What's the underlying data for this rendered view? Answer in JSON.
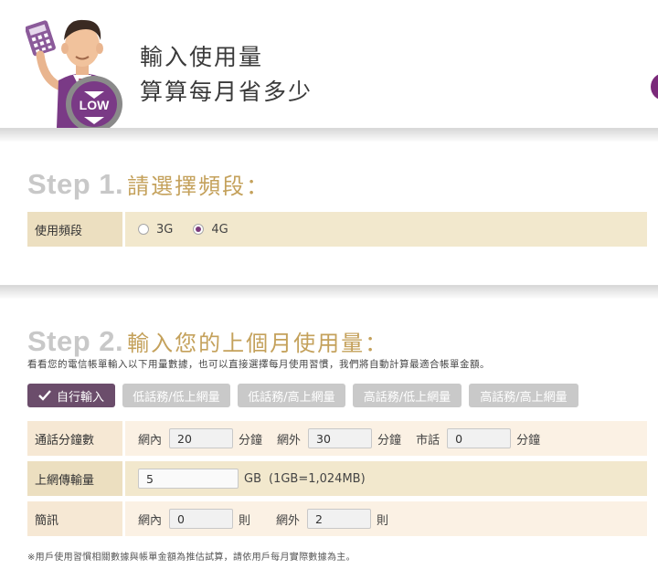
{
  "header": {
    "title_line1": "輸入使用量",
    "title_line2": "算算每月省多少",
    "mascot_badge": "LOW"
  },
  "step1": {
    "num": "Step 1.",
    "title": "請選擇頻段：",
    "row_label": "使用頻段",
    "options": [
      {
        "label": "3G",
        "checked": false
      },
      {
        "label": "4G",
        "checked": true
      }
    ]
  },
  "step2": {
    "num": "Step 2.",
    "title": "輸入您的上個月使用量：",
    "description": "看看您的電信帳單輸入以下用量數據，也可以直接選擇每月使用習慣，我們將自動計算最適合帳單金額。",
    "tabs": [
      {
        "label": "自行輸入",
        "active": true
      },
      {
        "label": "低話務/低上網量",
        "active": false
      },
      {
        "label": "低話務/高上網量",
        "active": false
      },
      {
        "label": "高話務/低上網量",
        "active": false
      },
      {
        "label": "高話務/高上網量",
        "active": false
      }
    ],
    "call": {
      "label": "通話分鐘數",
      "onnet_label": "網內",
      "onnet_value": "20",
      "offnet_label": "網外",
      "offnet_value": "30",
      "local_label": "市話",
      "local_value": "0",
      "unit": "分鐘"
    },
    "data": {
      "label": "上網傳輸量",
      "value": "5",
      "unit": "GB",
      "note": "(1GB=1,024MB)"
    },
    "sms": {
      "label": "簡訊",
      "onnet_label": "網內",
      "onnet_value": "0",
      "offnet_label": "網外",
      "offnet_value": "2",
      "unit": "則"
    },
    "footnote": "※用戶使用習慣相關數據與帳單金額為推估試算，請依用戶每月實際數據為主。"
  },
  "colors": {
    "accent_gold": "#c4a15b",
    "accent_purple": "#6b4d6b",
    "row_tan": "#ecdfc0",
    "row_cream": "#fbf1e4"
  },
  "icons": {
    "mascot": "man-with-calculator-illustration",
    "tab_check": "check-icon"
  }
}
